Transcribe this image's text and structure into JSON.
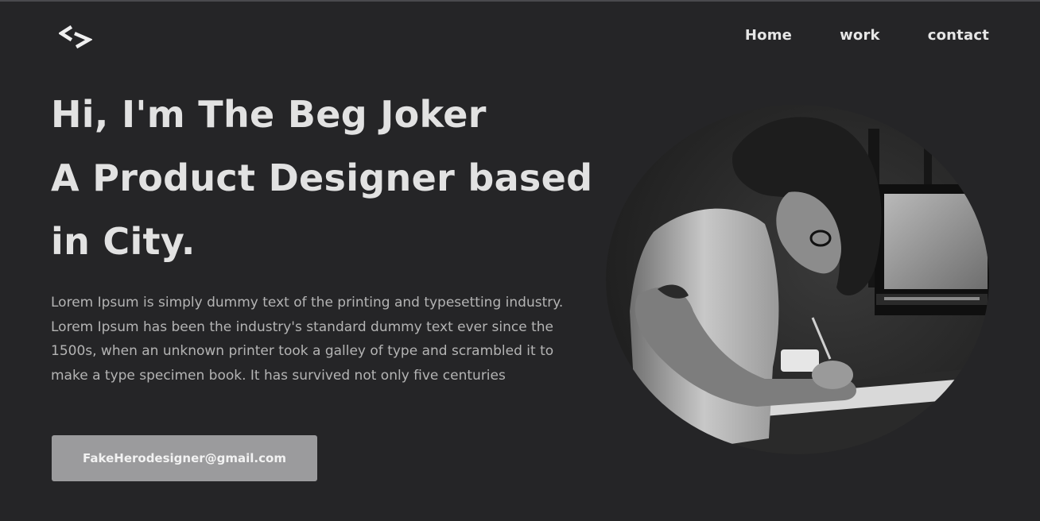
{
  "header": {
    "logo_icon": "code-brackets-icon",
    "nav": [
      {
        "label": "Home"
      },
      {
        "label": "work"
      },
      {
        "label": "contact"
      }
    ]
  },
  "hero": {
    "title_line1": "Hi, I'm The Beg Joker",
    "title_line2": "A Product Designer based in City.",
    "description": "Lorem Ipsum is simply dummy text of the printing and typesetting industry. Lorem Ipsum has been the industry's standard dummy text ever since the 1500s, when an unknown printer took a galley of type and scrambled it to make a type specimen book. It has survived not only five centuries",
    "email_button": "FakeHerodesigner@gmail.com",
    "portrait_icon": "person-writing-at-desk-photo"
  },
  "colors": {
    "background": "#252527",
    "heading": "#e2e2e2",
    "body_text": "#b4b4b4",
    "button_bg": "#9b9b9d"
  }
}
